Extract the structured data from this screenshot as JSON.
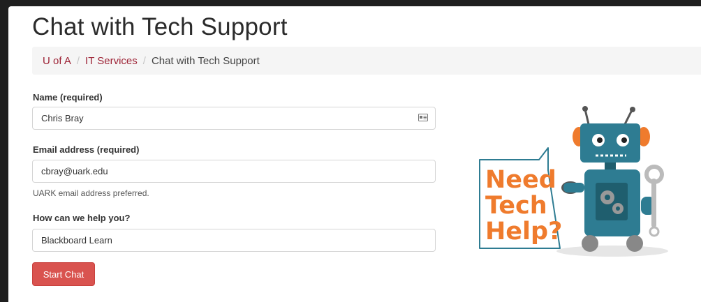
{
  "page": {
    "title": "Chat with Tech Support"
  },
  "breadcrumb": {
    "items": [
      {
        "label": "U of A"
      },
      {
        "label": "IT Services"
      },
      {
        "label": "Chat with Tech Support"
      }
    ],
    "separator": "/"
  },
  "form": {
    "name": {
      "label": "Name (required)",
      "value": "Chris Bray"
    },
    "email": {
      "label": "Email address (required)",
      "value": "cbray@uark.edu",
      "help": "UARK email address preferred."
    },
    "help": {
      "label": "How can we help you?",
      "value": "Blackboard Learn"
    },
    "submit_label": "Start Chat"
  },
  "illustration": {
    "speech_lines": [
      "Need",
      "Tech",
      "Help?"
    ]
  },
  "colors": {
    "accent_link": "#9d2235",
    "button": "#d9534f",
    "speech_text": "#ef7b2d",
    "robot_body": "#2e7c92"
  }
}
